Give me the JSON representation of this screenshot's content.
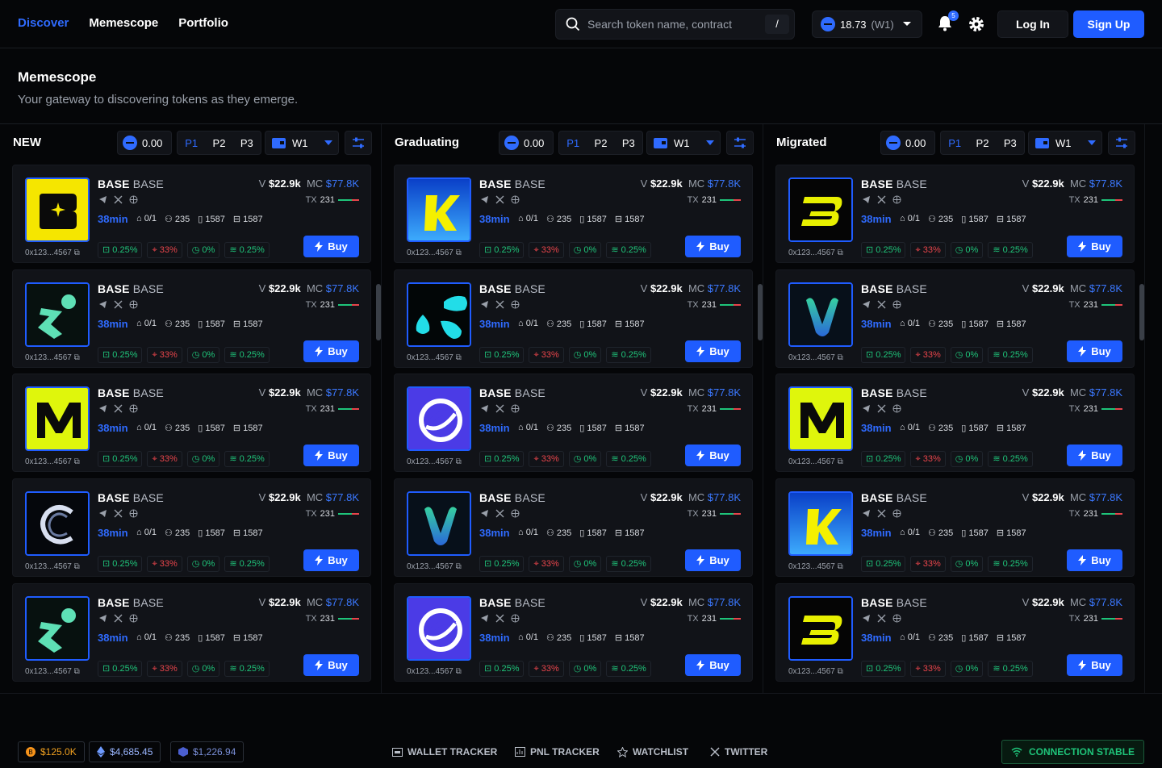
{
  "nav": {
    "discover": "Discover",
    "memescope": "Memescope",
    "portfolio": "Portfolio"
  },
  "search": {
    "placeholder": "Search token name, contract",
    "shortcut": "/"
  },
  "wallet": {
    "balance": "18.73",
    "label": "(W1)"
  },
  "notifications": {
    "count": "5"
  },
  "auth": {
    "login": "Log In",
    "signup": "Sign Up"
  },
  "page": {
    "title": "Memescope",
    "subtitle": "Your gateway to discovering tokens as they emerge."
  },
  "columns": [
    {
      "title": "NEW",
      "sol": "0.00",
      "presets": [
        "P1",
        "P2",
        "P3"
      ],
      "wallet": "W1"
    },
    {
      "title": "Graduating",
      "sol": "0.00",
      "presets": [
        "P1",
        "P2",
        "P3"
      ],
      "wallet": "W1"
    },
    {
      "title": "Migrated",
      "sol": "0.00",
      "presets": [
        "P1",
        "P2",
        "P3"
      ],
      "wallet": "W1"
    }
  ],
  "card": {
    "name": "BASE",
    "symbol": "BASE",
    "address": "0x123...4567",
    "age": "38min",
    "holders_ratio": "0/1",
    "holders": "235",
    "snipers": "1587",
    "bundles": "1587",
    "v_label": "V",
    "volume": "$22.9k",
    "mc_label": "MC",
    "market_cap": "$77.8K",
    "tx_label": "TX",
    "tx": "231",
    "top10": "0.25%",
    "dev": "33%",
    "sniper_pct": "0%",
    "insiders": "0.25%",
    "buy": "Buy"
  },
  "logos": [
    [
      "yellow-logo",
      "teal-k-logo",
      "blue-m-logo",
      "c-ring-logo",
      "teal-k-logo"
    ],
    [
      "yellow-k-logo",
      "cyan-drops-logo",
      "indigo-swirl-logo",
      "v-logo",
      "indigo-swirl-logo"
    ],
    [
      "yellow-b-logo",
      "v-logo",
      "lime-m-logo",
      "yellow-k-logo",
      "yellow-b-logo"
    ]
  ],
  "footer": {
    "btc": "$125.0K",
    "eth": "$4,685.45",
    "sol": "$1,226.94",
    "wallet_tracker": "WALLET TRACKER",
    "pnl_tracker": "PNL TRACKER",
    "watchlist": "WATCHLIST",
    "twitter": "TWITTER",
    "connection": "CONNECTION STABLE"
  },
  "colors": {
    "accent": "#1f5cff",
    "positive": "#1fc47a",
    "negative": "#e8454b"
  }
}
